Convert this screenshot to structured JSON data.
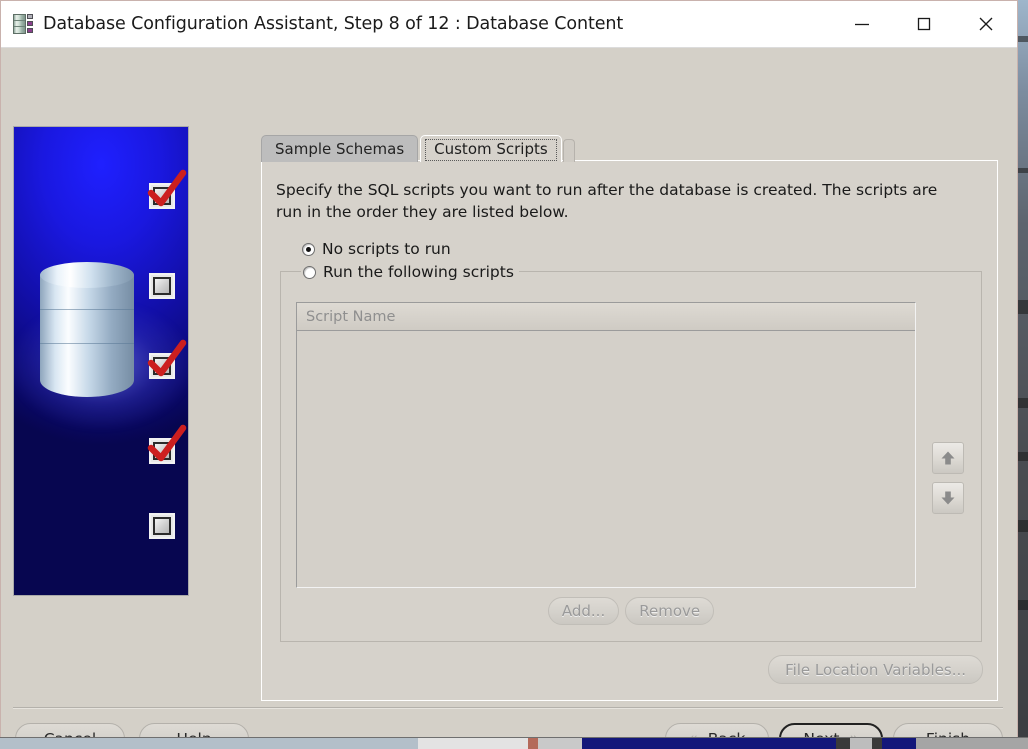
{
  "window": {
    "title": "Database Configuration Assistant, Step 8 of 12 : Database Content",
    "icon": "database-icon",
    "controls": {
      "minimize": "minimize-icon",
      "maximize": "maximize-icon",
      "close": "close-icon"
    }
  },
  "banner": {
    "alt": "database-checklist-graphic",
    "background_color": "#1a18e0",
    "cylinder_color": "#cfe0ee",
    "check_color": "#cc1f1f"
  },
  "tabs": [
    {
      "label": "Sample Schemas",
      "active": false
    },
    {
      "label": "Custom Scripts",
      "active": true
    }
  ],
  "panel": {
    "description": "Specify the SQL scripts you want to run after the database is created. The scripts are run in the order they are listed below.",
    "radio_no_scripts": {
      "label": "No scripts to run",
      "selected": true
    },
    "group": {
      "radio_run_scripts": {
        "label": "Run the following scripts",
        "selected": false
      },
      "table": {
        "columns": [
          "Script Name"
        ],
        "rows": []
      },
      "reorder": {
        "move_up": "arrow-up-icon",
        "move_down": "arrow-down-icon"
      },
      "add_label": "Add...",
      "remove_label": "Remove"
    },
    "file_location_label": "File Location Variables..."
  },
  "footer": {
    "cancel": "Cancel",
    "help": "Help",
    "back": {
      "label": "Back",
      "mnemonic": "B",
      "chevron": "«"
    },
    "next": {
      "label": "Next",
      "mnemonic": "N",
      "chevron": "»",
      "default": true
    },
    "finish": {
      "label": "Finish",
      "mnemonic": "F"
    }
  }
}
